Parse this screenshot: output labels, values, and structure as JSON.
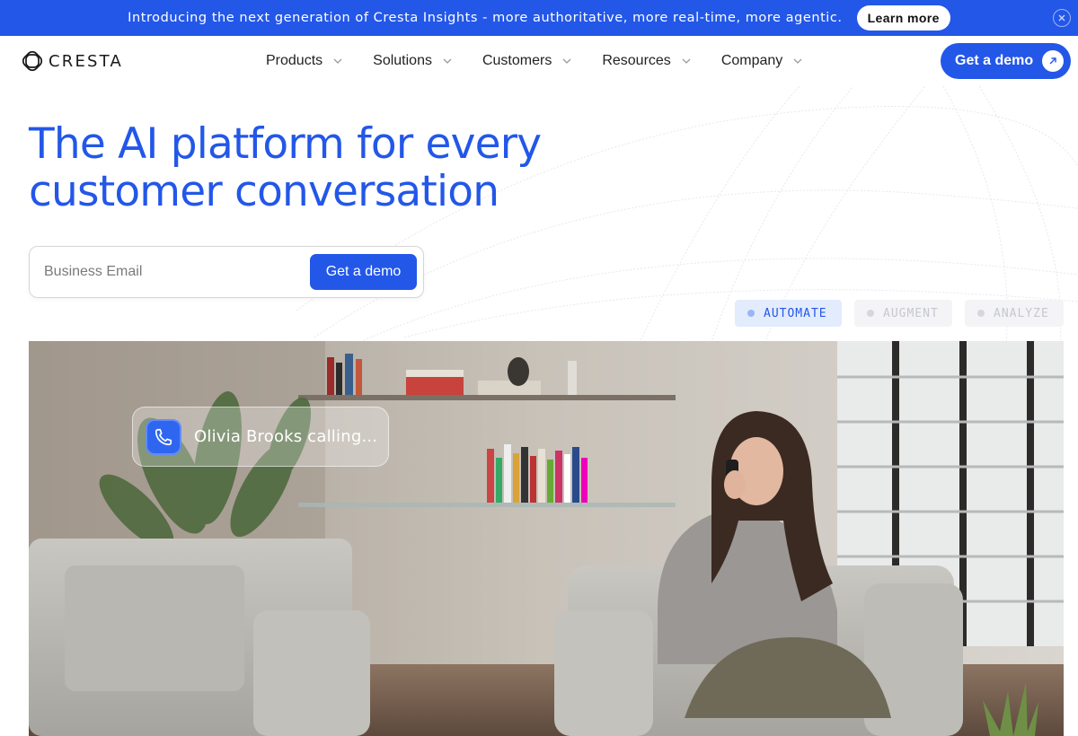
{
  "announcement": {
    "text": "Introducing the next generation of Cresta Insights - more authoritative, more real-time, more agentic.",
    "button_label": "Learn more",
    "close_icon": "close-icon"
  },
  "nav": {
    "logo_text": "CRESTA",
    "items": [
      {
        "label": "Products"
      },
      {
        "label": "Solutions"
      },
      {
        "label": "Customers"
      },
      {
        "label": "Resources"
      },
      {
        "label": "Company"
      }
    ],
    "cta_label": "Get a demo"
  },
  "hero": {
    "title_line1": "The AI platform for every",
    "title_line2": "customer conversation",
    "email_placeholder": "Business Email",
    "email_button": "Get a demo"
  },
  "tabs": [
    {
      "label": "AUTOMATE",
      "active": true
    },
    {
      "label": "AUGMENT",
      "active": false
    },
    {
      "label": "ANALYZE",
      "active": false
    }
  ],
  "media": {
    "call_text": "Olivia Brooks calling..."
  },
  "colors": {
    "brand_blue": "#2357e8",
    "tab_active_bg": "#e3ecfd"
  }
}
